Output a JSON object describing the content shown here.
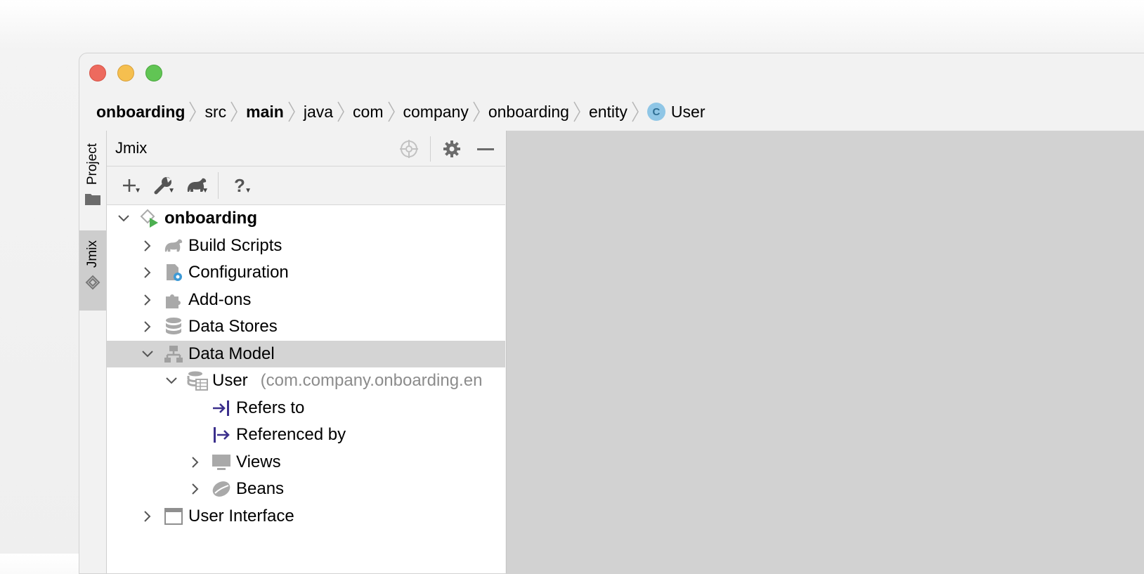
{
  "breadcrumb": [
    {
      "label": "onboarding",
      "bold": true
    },
    {
      "label": "src",
      "bold": false
    },
    {
      "label": "main",
      "bold": true
    },
    {
      "label": "java",
      "bold": false
    },
    {
      "label": "com",
      "bold": false
    },
    {
      "label": "company",
      "bold": false
    },
    {
      "label": "onboarding",
      "bold": false
    },
    {
      "label": "entity",
      "bold": false
    },
    {
      "label": "User",
      "bold": false,
      "badge": "C"
    }
  ],
  "side_tabs": {
    "project": "Project",
    "jmix": "Jmix"
  },
  "panel": {
    "title": "Jmix",
    "header_icons": [
      "crosshair-icon",
      "gear-icon",
      "minimize-icon"
    ],
    "toolbar": [
      "add-icon",
      "wrench-icon",
      "gradle-icon",
      "help-icon"
    ]
  },
  "tree": {
    "root": "onboarding",
    "build_scripts": "Build Scripts",
    "configuration": "Configuration",
    "addons": "Add-ons",
    "data_stores": "Data Stores",
    "data_model": "Data Model",
    "user": "User",
    "user_package": "(com.company.onboarding.en",
    "refers_to": "Refers to",
    "referenced_by": "Referenced by",
    "views": "Views",
    "beans": "Beans",
    "user_interface": "User Interface"
  },
  "colors": {
    "selection": "#d4d4d4",
    "editor_bg": "#d2d2d2",
    "reference_icon": "#3b2f8c"
  }
}
